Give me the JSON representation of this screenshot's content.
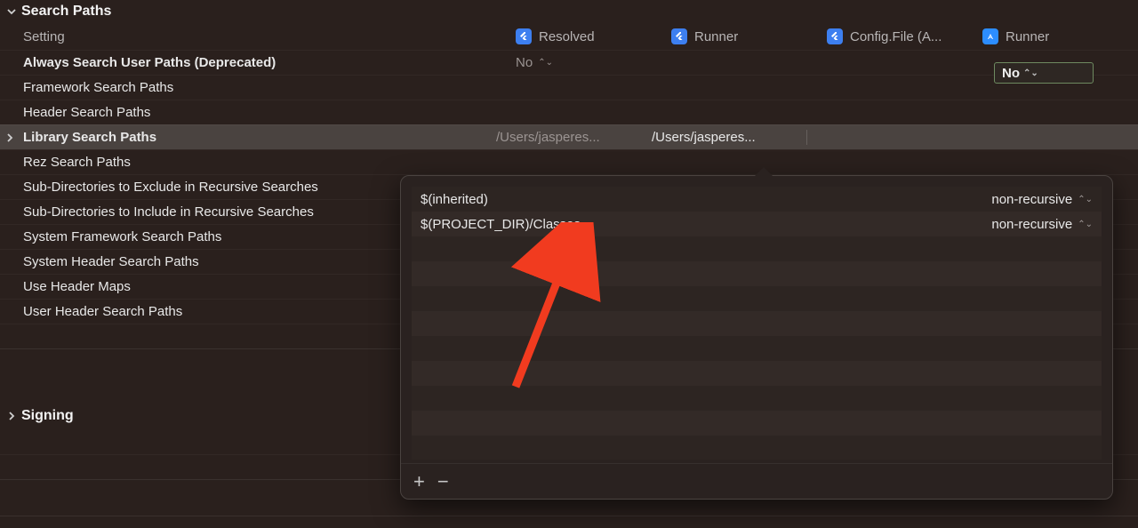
{
  "sections": {
    "searchPaths": {
      "title": "Search Paths",
      "columnHeader": "Setting",
      "targets": {
        "resolved": "Resolved",
        "runner1": "Runner",
        "configFile": "Config.File (A...",
        "runner2": "Runner"
      }
    },
    "signing": {
      "title": "Signing"
    }
  },
  "rows": {
    "alwaysSearch": {
      "label": "Always Search User Paths (Deprecated)",
      "resolved": "No",
      "editable": "No"
    },
    "framework": {
      "label": "Framework Search Paths"
    },
    "header": {
      "label": "Header Search Paths"
    },
    "library": {
      "label": "Library Search Paths",
      "resolved": "/Users/jasperes...",
      "runner": "/Users/jasperes..."
    },
    "rez": {
      "label": "Rez Search Paths"
    },
    "subExclude": {
      "label": "Sub-Directories to Exclude in Recursive Searches"
    },
    "subInclude": {
      "label": "Sub-Directories to Include in Recursive Searches"
    },
    "sysFramework": {
      "label": "System Framework Search Paths"
    },
    "sysHeader": {
      "label": "System Header Search Paths"
    },
    "useHeaderMaps": {
      "label": "Use Header Maps"
    },
    "userHeader": {
      "label": "User Header Search Paths"
    }
  },
  "popover": {
    "entries": [
      {
        "path": "$(inherited)",
        "mode": "non-recursive"
      },
      {
        "path": "$(PROJECT_DIR)/Classes",
        "mode": "non-recursive"
      }
    ],
    "addLabel": "+",
    "removeLabel": "−"
  },
  "glyphs": {
    "chevDown": "˅",
    "chevRight": "›",
    "caret": "⌄"
  }
}
